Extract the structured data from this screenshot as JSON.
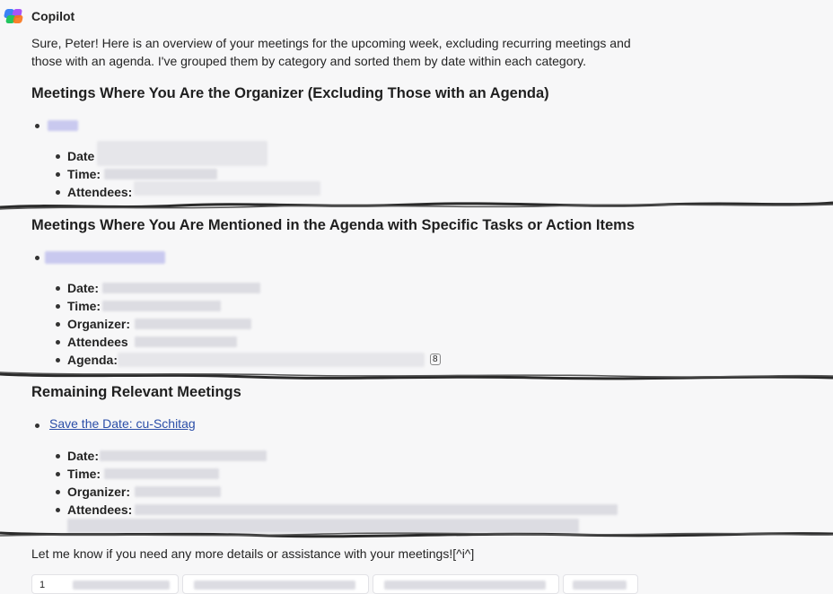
{
  "header": {
    "title": "Copilot",
    "logo_icon": "copilot-logo-icon"
  },
  "intro": "Sure, Peter! Here is an overview of your meetings for the upcoming week, excluding recurring meetings and those with an agenda. I've grouped them by category and sorted them by date within each category.",
  "sections": [
    {
      "heading": "Meetings Where You Are the Organizer (Excluding Those with an Agenda)",
      "fields": [
        "Date",
        "Time:",
        "Attendees:"
      ]
    },
    {
      "heading": "Meetings Where You Are Mentioned in the Agenda with Specific Tasks or Action Items",
      "fields": [
        "Date:",
        "Time:",
        "Organizer:",
        "Attendees",
        "Agenda:"
      ],
      "citation": "8"
    },
    {
      "heading": "Remaining Relevant Meetings",
      "meeting_link": "Save the Date: cu-Schitag",
      "fields": [
        "Date:",
        "Time:",
        "Organizer:",
        "Attendees:"
      ]
    }
  ],
  "closing": "Let me know if you need any more details or assistance with your meetings![^i^]",
  "footer_ref": "1"
}
